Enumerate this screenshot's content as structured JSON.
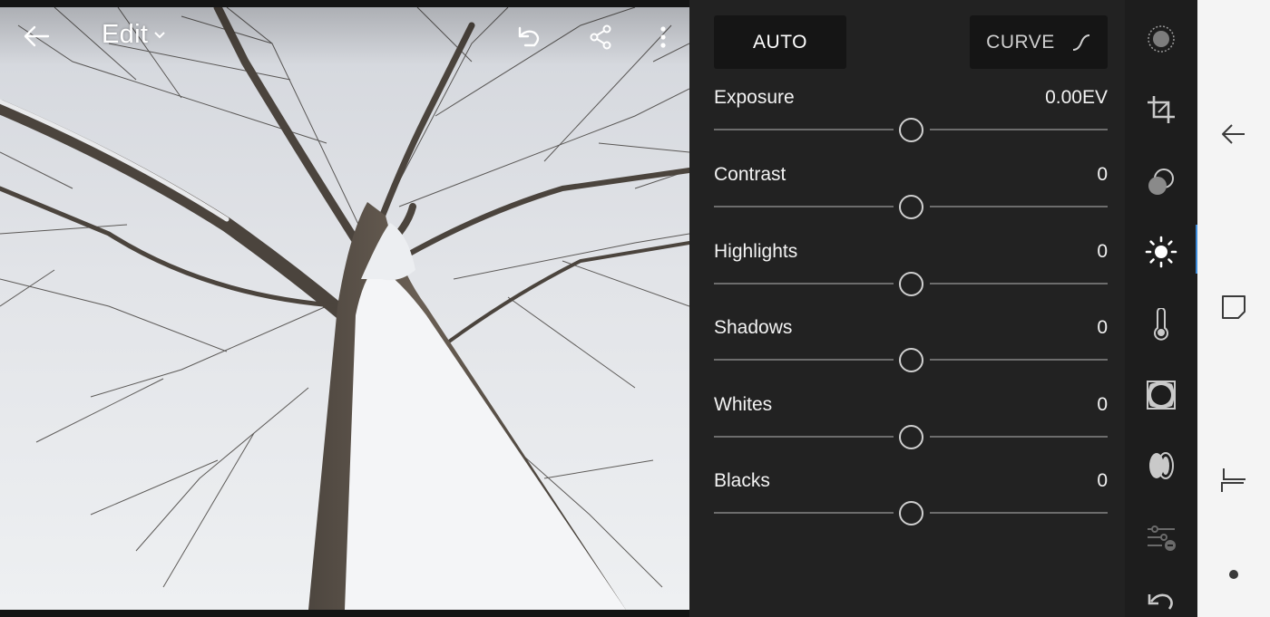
{
  "header": {
    "back_icon": "arrow-left-icon",
    "title": "Edit",
    "title_menu_icon": "chevron-down-icon",
    "undo_icon": "undo-icon",
    "share_icon": "share-icon",
    "more_icon": "more-vertical-icon"
  },
  "panel": {
    "auto_label": "AUTO",
    "curve_label": "CURVE",
    "curve_icon": "curve-icon",
    "sliders": [
      {
        "label": "Exposure",
        "value": "0.00EV",
        "position": 0.5
      },
      {
        "label": "Contrast",
        "value": "0",
        "position": 0.5
      },
      {
        "label": "Highlights",
        "value": "0",
        "position": 0.5
      },
      {
        "label": "Shadows",
        "value": "0",
        "position": 0.5
      },
      {
        "label": "Whites",
        "value": "0",
        "position": 0.5
      },
      {
        "label": "Blacks",
        "value": "0",
        "position": 0.5
      }
    ]
  },
  "tools": [
    {
      "name": "presets-icon"
    },
    {
      "name": "crop-icon"
    },
    {
      "name": "selective-icon"
    },
    {
      "name": "light-icon",
      "active": true
    },
    {
      "name": "color-temperature-icon"
    },
    {
      "name": "vignette-icon"
    },
    {
      "name": "optics-icon"
    },
    {
      "name": "detail-icon"
    },
    {
      "name": "reset-icon"
    }
  ],
  "system_nav": [
    "back-icon",
    "recents-icon",
    "recent-apps-icon",
    "home-icon"
  ],
  "colors": {
    "panel_bg": "#222222",
    "button_bg": "#151515",
    "accent": "#3b8ad9",
    "nav_bg": "#f4f4f4"
  }
}
